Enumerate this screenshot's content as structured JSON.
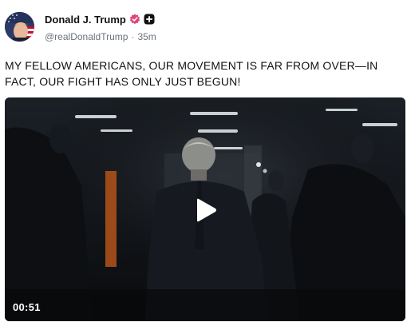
{
  "post": {
    "author": {
      "display_name": "Donald J. Trump",
      "handle": "@realDonaldTrump",
      "separator": "·",
      "time_ago": "35m"
    },
    "badges": {
      "verified_icon": "verified-badge-icon",
      "verified_color": "#e0457b",
      "plus_icon": "plus-badge-icon"
    },
    "text": "MY FELLOW AMERICANS, OUR MOVEMENT IS FAR FROM OVER—IN FACT, OUR FIGHT HAS ONLY JUST BEGUN!",
    "video": {
      "duration": "00:51",
      "play_icon": "play-icon"
    }
  }
}
